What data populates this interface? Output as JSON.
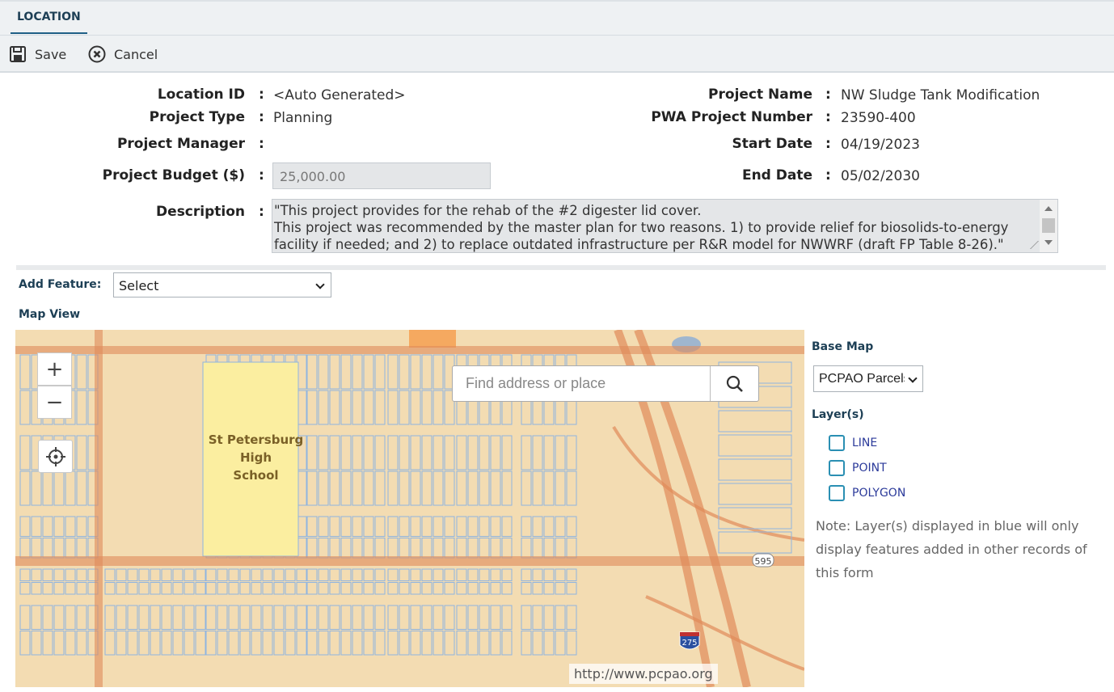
{
  "tab": {
    "label": "LOCATION"
  },
  "toolbar": {
    "save_label": "Save",
    "cancel_label": "Cancel"
  },
  "form": {
    "location_id": {
      "label": "Location ID",
      "value": "<Auto Generated>"
    },
    "project_type": {
      "label": "Project Type",
      "value": "Planning"
    },
    "project_manager": {
      "label": "Project Manager",
      "value": ""
    },
    "project_budget": {
      "label": "Project Budget ($)",
      "value": "25,000.00"
    },
    "description": {
      "label": "Description",
      "value": "\"This project provides for the rehab of the #2 digester lid cover.\nThis project was recommended by the master plan for two reasons. 1) to provide relief for biosolids-to-energy facility if needed; and 2) to replace outdated infrastructure per R&R model for NWWRF (draft FP Table 8-26).\""
    },
    "project_name": {
      "label": "Project Name",
      "value": "NW Sludge Tank Modification"
    },
    "pwa_project_number": {
      "label": "PWA Project Number",
      "value": "23590-400"
    },
    "start_date": {
      "label": "Start Date",
      "value": "04/19/2023"
    },
    "end_date": {
      "label": "End Date",
      "value": "05/02/2030"
    },
    "colon": ":"
  },
  "add_feature": {
    "label": "Add Feature:",
    "selected": "Select"
  },
  "map": {
    "title": "Map View",
    "zoom_in": "+",
    "zoom_out": "−",
    "search_placeholder": "Find address or place",
    "school_label": [
      "St Petersburg",
      "High",
      "School"
    ],
    "road_shield_595": "595",
    "road_shield_275": "275",
    "attribution": "http://www.pcpao.org",
    "icons": [
      "locate-icon",
      "search-icon"
    ]
  },
  "side": {
    "base_map_label": "Base Map",
    "base_map_selected": "PCPAO Parcels",
    "layers_label": "Layer(s)",
    "layers": [
      "LINE",
      "POINT",
      "POLYGON"
    ],
    "note": "Note: Layer(s) displayed in blue will only display features added in other records of this form"
  },
  "colors": {
    "accent": "#1f5f86",
    "label_blue": "#1d3f55",
    "checkbox_border": "#2a8fb3",
    "layer_text": "#2b3a9a",
    "map_land": "#f3dcb2",
    "school_fill": "#fbeea0",
    "parcel_line": "#8fb4e0",
    "road": "#e08a5a"
  }
}
